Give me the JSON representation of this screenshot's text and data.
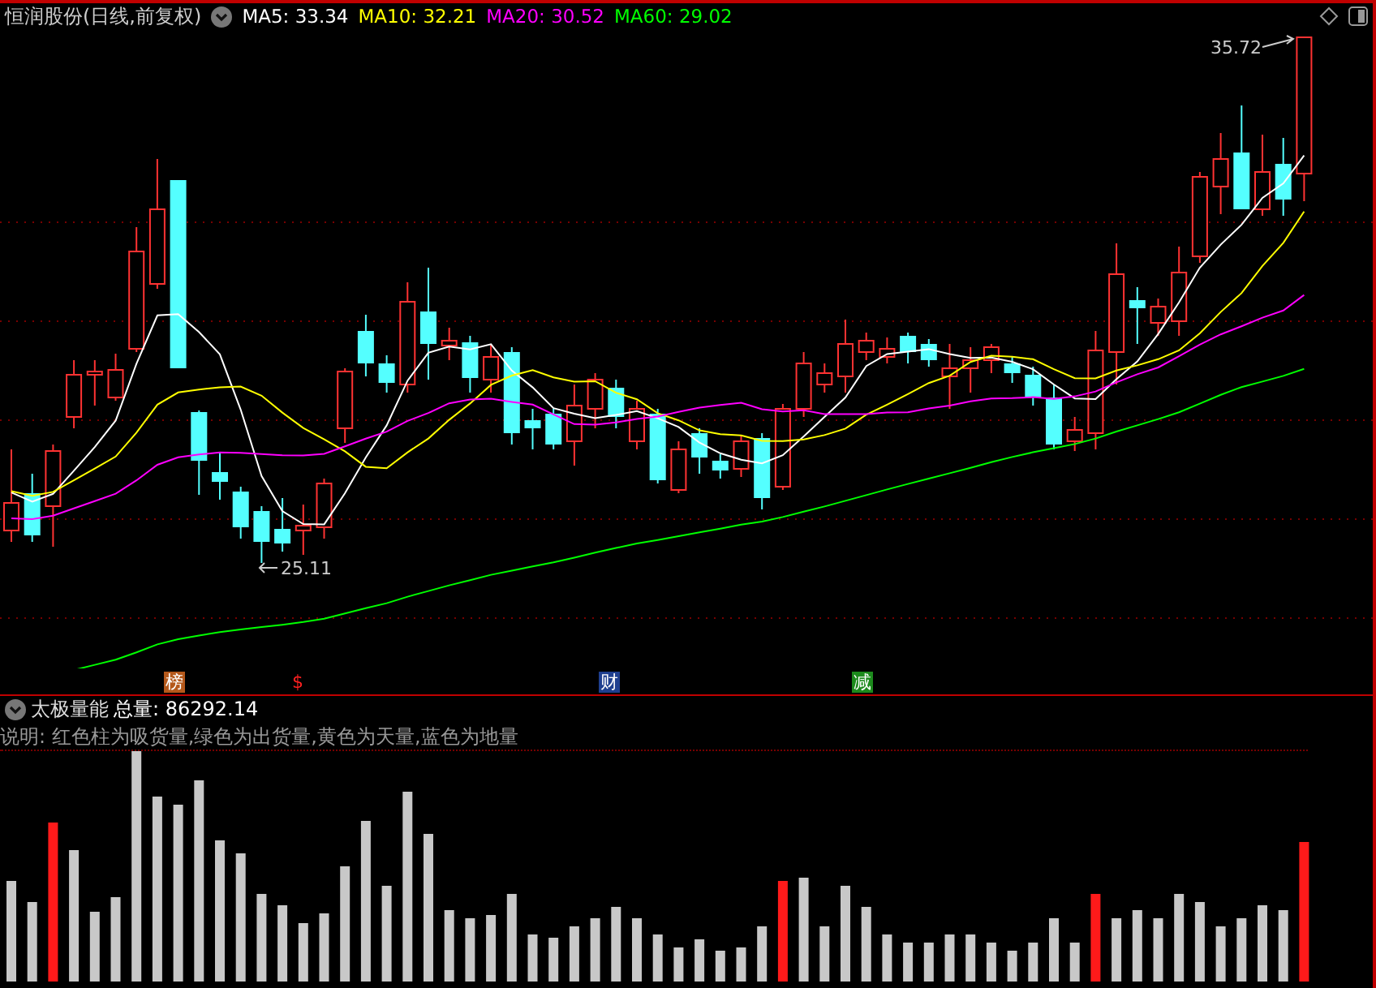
{
  "header": {
    "title": "恒润股份(日线,前复权)",
    "indicators": [
      {
        "label": "MA5: 33.34",
        "color": "#ffffff"
      },
      {
        "label": "MA10: 32.21",
        "color": "#ffff00"
      },
      {
        "label": "MA20: 30.52",
        "color": "#ff00ff"
      },
      {
        "label": "MA60: 29.02",
        "color": "#00ff00"
      }
    ]
  },
  "chart": {
    "high_label": "35.72",
    "low_label": "25.11"
  },
  "event_markers": [
    {
      "label": "榜",
      "kind": "tag",
      "color": "#b5591b"
    },
    {
      "label": "$",
      "kind": "text",
      "color": "#ff2020"
    },
    {
      "label": "财",
      "kind": "tag",
      "color": "#1f3f8f"
    },
    {
      "label": "减",
      "kind": "tag",
      "color": "#1c8a1c"
    }
  ],
  "volume_panel": {
    "title": "太极量能",
    "total": "总量: 86292.14",
    "note": "说明: 红色柱为吸货量,绿色为出货量,黄色为天量,蓝色为地量"
  }
}
